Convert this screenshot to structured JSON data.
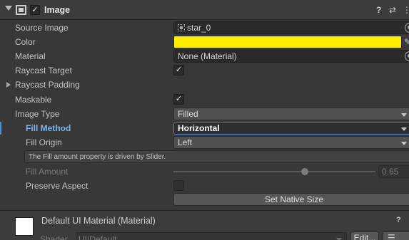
{
  "component": {
    "title": "Image",
    "enabled": "✓",
    "icons": {
      "help": "?",
      "presets": "⇄",
      "more": "⋮"
    }
  },
  "fields": {
    "source_image": {
      "label": "Source Image",
      "value": "star_0"
    },
    "color": {
      "label": "Color",
      "value": "#ffee00"
    },
    "material": {
      "label": "Material",
      "value": "None (Material)"
    },
    "raycast_target": {
      "label": "Raycast Target",
      "checked": "✓"
    },
    "raycast_padding": {
      "label": "Raycast Padding"
    },
    "maskable": {
      "label": "Maskable",
      "checked": "✓"
    },
    "image_type": {
      "label": "Image Type",
      "value": "Filled"
    },
    "fill_method": {
      "label": "Fill Method",
      "value": "Horizontal"
    },
    "fill_origin": {
      "label": "Fill Origin",
      "value": "Left"
    },
    "help_text": "The Fill amount property is driven by Slider.",
    "fill_amount": {
      "label": "Fill Amount",
      "value": "0.65",
      "fraction": 0.65
    },
    "preserve_aspect": {
      "label": "Preserve Aspect",
      "checked": ""
    }
  },
  "buttons": {
    "set_native_size": "Set Native Size"
  },
  "material_section": {
    "title": "Default UI Material (Material)",
    "help": "?",
    "shader_label": "Shader",
    "shader_value": "UI/Default",
    "edit_label": "Edit...",
    "list_icon": "☰"
  }
}
